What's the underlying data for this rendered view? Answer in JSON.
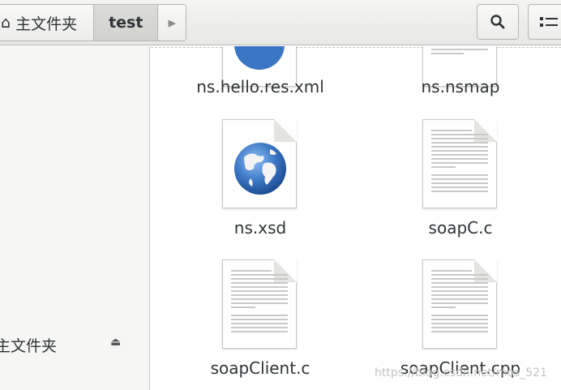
{
  "header": {
    "home_label": "主文件夹",
    "current_folder": "test",
    "more_arrow": "▸",
    "search_icon": "search-icon",
    "view_icon": "list-view-icon"
  },
  "sidebar": {
    "bottom_item_label": "主文件夹",
    "bottom_item_icon": "eject-icon"
  },
  "files": [
    {
      "name": "ns.hello.res.xml",
      "icon": "globe-icon"
    },
    {
      "name": "ns.nsmap",
      "icon": "text-document-icon"
    },
    {
      "name": "ns.xsd",
      "icon": "globe-icon"
    },
    {
      "name": "soapC.c",
      "icon": "text-document-icon"
    },
    {
      "name": "soapClient.c",
      "icon": "text-document-icon"
    },
    {
      "name": "soapClient.cpp",
      "icon": "text-document-icon"
    }
  ],
  "watermark": "https://blog.csdn.net/mos_521",
  "colors": {
    "globe_blue": "#3b76c4",
    "globe_land": "#f3f3f3",
    "header_bg": "#ececea",
    "sidebar_bg": "#f6f6f5"
  }
}
